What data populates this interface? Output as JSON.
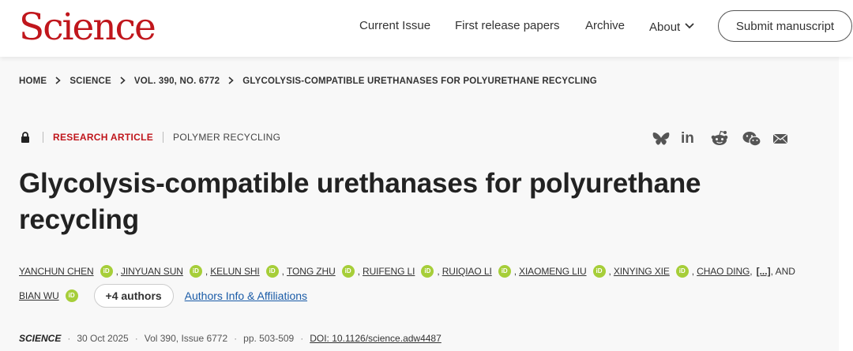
{
  "header": {
    "logo": "Science",
    "nav": [
      "Current Issue",
      "First release papers",
      "Archive",
      "About"
    ],
    "submit_label": "Submit manuscript"
  },
  "breadcrumb": [
    "HOME",
    "SCIENCE",
    "VOL. 390, NO. 6772",
    "GLYCOLYSIS-COMPATIBLE URETHANASES FOR POLYURETHANE RECYCLING"
  ],
  "article": {
    "access_icon": "lock-icon",
    "type": "RESEARCH ARTICLE",
    "category": "POLYMER RECYCLING",
    "title_line1": "Glycolysis-compatible urethanases for polyurethane",
    "title_line2": "recycling"
  },
  "share_icons": [
    "bluesky-icon",
    "linkedin-icon",
    "reddit-icon",
    "wechat-icon",
    "email-icon"
  ],
  "authors": {
    "names": [
      "YANCHUN CHEN",
      "JINYUAN SUN",
      "KELUN SHI",
      "TONG ZHU",
      "RUIFENG LI",
      "RUIQIAO LI",
      "XIAOMENG LIU",
      "XINYING XIE",
      "CHAO DING",
      "BIAN WU"
    ],
    "ellipsis": "[...]",
    "and": ", AND",
    "orcid_label": "iD",
    "more_label": "+4 authors",
    "affiliations_label": "Authors Info & Affiliations"
  },
  "citation": {
    "journal": "SCIENCE",
    "date": "30 Oct 2025",
    "volume": "Vol 390, Issue 6772",
    "pages": "pp. 503-509",
    "doi": "DOI: 10.1126/science.adw4487"
  },
  "colors": {
    "brand_red": "#c0161c",
    "orcid_green": "#a6ce39",
    "link_blue": "#1a5ba7"
  }
}
